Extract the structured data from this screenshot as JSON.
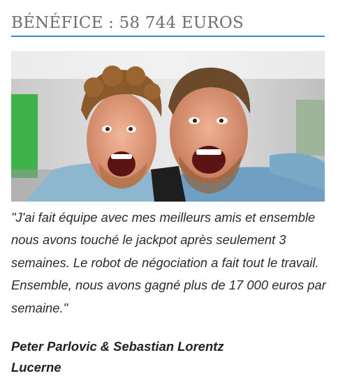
{
  "heading": {
    "title": "BÉNÉFICE : 58 744 EUROS",
    "accent_color": "#2a8fd0"
  },
  "photo": {
    "subject": "two-men-selfie-photo"
  },
  "testimonial": {
    "quote": "\"J'ai fait équipe avec mes meilleurs amis et ensemble nous avons touché le jackpot après seulement 3 semaines. Le robot de négociation a fait tout le travail. Ensemble, nous avons gagné plus de 17 000 euros par semaine.\"",
    "author_names": "Peter Parlovic & Sebastian Lorentz",
    "author_city": "Lucerne"
  }
}
